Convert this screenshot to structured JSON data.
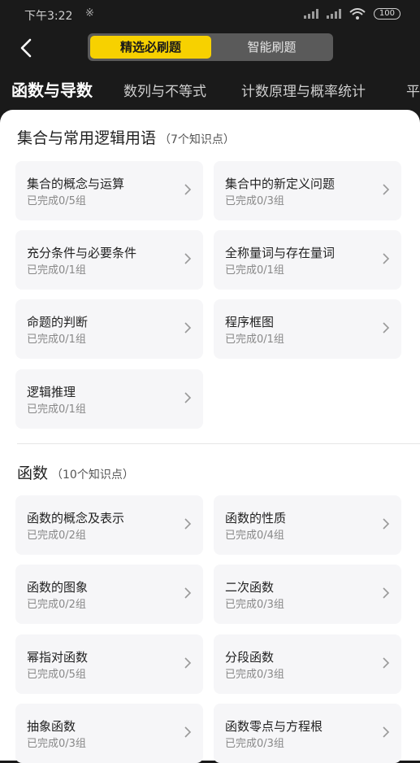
{
  "status": {
    "time": "下午3:22",
    "extra": "※",
    "battery": "100"
  },
  "segment": {
    "active": "精选必刷题",
    "inactive": "智能刷题"
  },
  "tabs": [
    "函数与导数",
    "数列与不等式",
    "计数原理与概率统计",
    "平"
  ],
  "sections": [
    {
      "title": "集合与常用逻辑用语",
      "count": "（7个知识点）",
      "items": [
        {
          "title": "集合的概念与运算",
          "progress": "已完成0/5组"
        },
        {
          "title": "集合中的新定义问题",
          "progress": "已完成0/3组"
        },
        {
          "title": "充分条件与必要条件",
          "progress": "已完成0/1组"
        },
        {
          "title": "全称量词与存在量词",
          "progress": "已完成0/1组"
        },
        {
          "title": "命题的判断",
          "progress": "已完成0/1组"
        },
        {
          "title": "程序框图",
          "progress": "已完成0/1组"
        },
        {
          "title": "逻辑推理",
          "progress": "已完成0/1组"
        }
      ]
    },
    {
      "title": "函数",
      "count": "（10个知识点）",
      "items": [
        {
          "title": "函数的概念及表示",
          "progress": "已完成0/2组"
        },
        {
          "title": "函数的性质",
          "progress": "已完成0/4组"
        },
        {
          "title": "函数的图象",
          "progress": "已完成0/2组"
        },
        {
          "title": "二次函数",
          "progress": "已完成0/3组"
        },
        {
          "title": "幂指对函数",
          "progress": "已完成0/5组"
        },
        {
          "title": "分段函数",
          "progress": "已完成0/3组"
        },
        {
          "title": "抽象函数",
          "progress": "已完成0/3组"
        },
        {
          "title": "函数零点与方程根",
          "progress": "已完成0/3组"
        }
      ]
    }
  ]
}
